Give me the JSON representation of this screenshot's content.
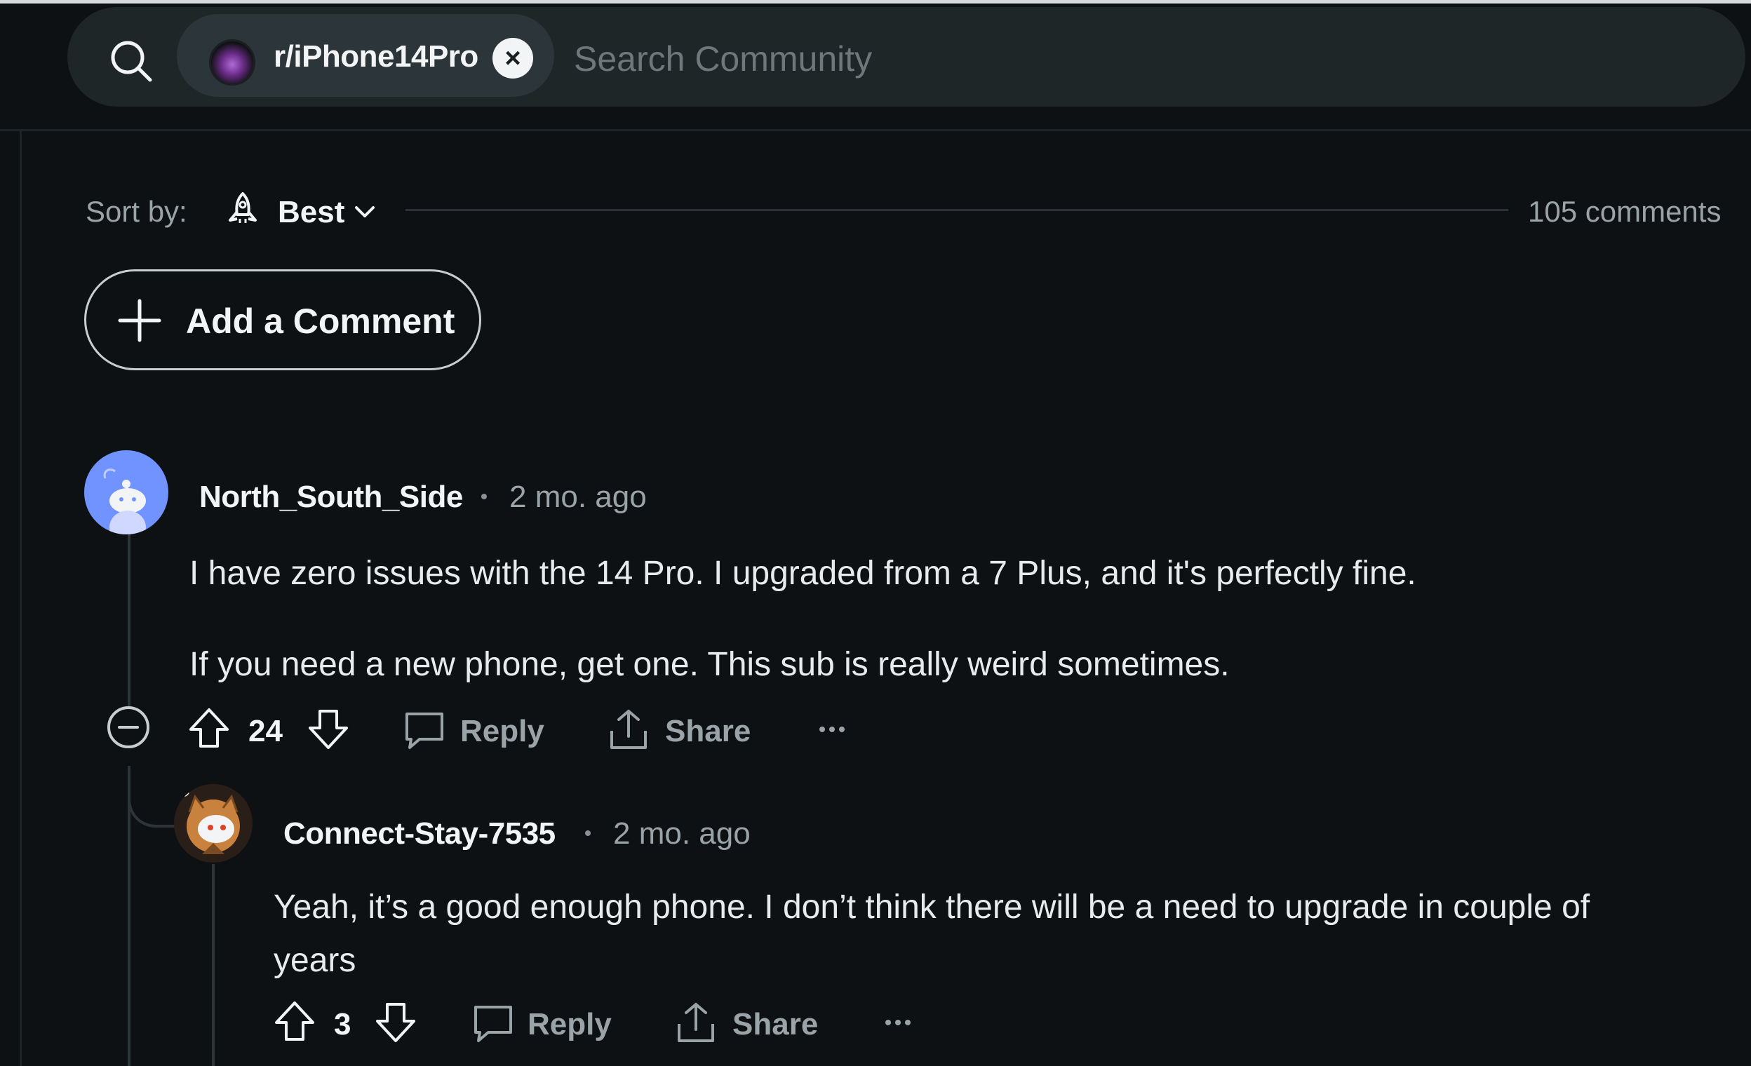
{
  "search": {
    "community": "r/iPhone14Pro",
    "placeholder": "Search Community"
  },
  "sort": {
    "label": "Sort by:",
    "value": "Best",
    "comment_count": "105 comments"
  },
  "add_comment_label": "Add a Comment",
  "comments": [
    {
      "username": "North_South_Side",
      "time": "2 mo. ago",
      "paragraphs": [
        "I have zero issues with the 14 Pro. I upgraded from a 7 Plus, and it's perfectly fine.",
        "If you need a new phone, get one. This sub is really weird sometimes."
      ],
      "score": "24",
      "reply_label": "Reply",
      "share_label": "Share"
    },
    {
      "username": "Connect-Stay-7535",
      "time": "2 mo. ago",
      "paragraphs": [
        "Yeah, it’s a good enough phone. I don’t think there will be a need to upgrade in couple of",
        "years"
      ],
      "score": "3",
      "reply_label": "Reply",
      "share_label": "Share"
    }
  ],
  "icons": {
    "search": "search-icon",
    "close": "close-icon",
    "sort": "rocket-icon",
    "chevron": "chevron-down-icon",
    "add": "plus-icon",
    "collapse": "collapse-icon",
    "upvote": "upvote-icon",
    "downvote": "downvote-icon",
    "reply": "comment-icon",
    "share": "share-icon",
    "more": "more-icon"
  },
  "colors": {
    "background": "#0e1113",
    "search_bg": "#1f2628",
    "chip_bg": "#2c3539",
    "text": "#f2f4f5",
    "muted": "#9aa3a7",
    "avatar_blue": "#7193ff"
  }
}
